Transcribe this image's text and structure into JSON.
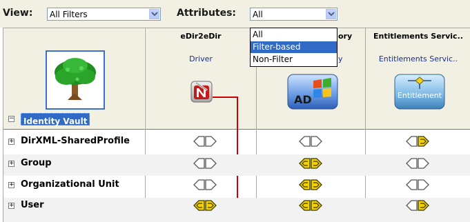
{
  "filter_bar": {
    "view_label": "View:",
    "view_value": "All Filters",
    "attributes_label": "Attributes:",
    "attributes_value": "All"
  },
  "attributes_dropdown": {
    "options": [
      "All",
      "Filter-based",
      "Non-Filter"
    ],
    "selected_index": 1
  },
  "vault": {
    "label": "Identity Vault",
    "icon": "tree-icon",
    "expander": "−"
  },
  "columns": [
    {
      "title": "eDir2eDir",
      "subtitle": "Driver",
      "icon": "edirectory-n-icon"
    },
    {
      "title": "ory",
      "subtitle": "y",
      "icon": "active-directory-icon",
      "icon_text": "AD"
    },
    {
      "title": "Entitlements Servic..",
      "subtitle": "Entitlements Servic..",
      "icon": "entitlement-icon",
      "icon_text": "Entitlement"
    }
  ],
  "rows": [
    {
      "label": "DirXML-SharedProfile",
      "expander": "+",
      "cells": [
        "empty",
        "empty",
        "right-yellow"
      ]
    },
    {
      "label": "Group",
      "expander": "+",
      "cells": [
        "empty",
        "both-yellow",
        "empty"
      ]
    },
    {
      "label": "Organizational Unit",
      "expander": "+",
      "cells": [
        "empty",
        "both-yellow",
        "empty"
      ]
    },
    {
      "label": "User",
      "expander": "+",
      "cells": [
        "both-yellow",
        "both-yellow",
        "right-yellow"
      ]
    }
  ],
  "colors": {
    "header_bg": "#f1f0e2",
    "selection": "#316ac5",
    "arrow_fill": "#f7d000",
    "arrow_stroke": "#3a3a00",
    "connector": "#cc0000"
  }
}
